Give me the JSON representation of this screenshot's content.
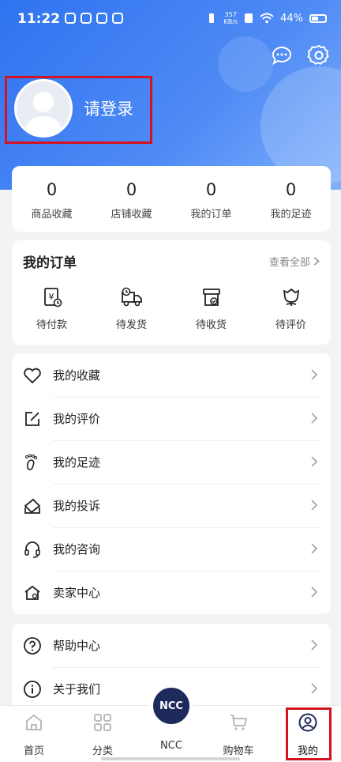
{
  "status_bar": {
    "time": "11:22",
    "net_speed_value": "357",
    "net_speed_unit": "KB/s",
    "battery": "44%"
  },
  "header": {
    "login_text": "请登录",
    "icons": [
      "message-icon",
      "settings-icon"
    ]
  },
  "stats": [
    {
      "value": "0",
      "label": "商品收藏"
    },
    {
      "value": "0",
      "label": "店铺收藏"
    },
    {
      "value": "0",
      "label": "我的订单"
    },
    {
      "value": "0",
      "label": "我的足迹"
    }
  ],
  "orders": {
    "title": "我的订单",
    "more": "查看全部",
    "items": [
      {
        "label": "待付款",
        "icon": "pending-payment-icon"
      },
      {
        "label": "待发货",
        "icon": "truck-icon"
      },
      {
        "label": "待收货",
        "icon": "box-icon"
      },
      {
        "label": "待评价",
        "icon": "flower-icon"
      }
    ]
  },
  "menu": [
    {
      "label": "我的收藏",
      "icon": "heart-icon"
    },
    {
      "label": "我的评价",
      "icon": "edit-icon"
    },
    {
      "label": "我的足迹",
      "icon": "footprint-icon"
    },
    {
      "label": "我的投诉",
      "icon": "complaint-icon"
    },
    {
      "label": "我的咨询",
      "icon": "headset-icon"
    },
    {
      "label": "卖家中心",
      "icon": "store-icon"
    }
  ],
  "menu2": [
    {
      "label": "帮助中心",
      "icon": "help-icon"
    },
    {
      "label": "关于我们",
      "icon": "info-icon"
    }
  ],
  "tabbar": {
    "tabs": [
      {
        "label": "首页",
        "icon": "home-icon"
      },
      {
        "label": "分类",
        "icon": "category-icon"
      },
      {
        "label": "NCC",
        "icon": "ncc-logo"
      },
      {
        "label": "购物车",
        "icon": "cart-icon"
      },
      {
        "label": "我的",
        "icon": "profile-icon"
      }
    ],
    "center_button": "NCC"
  },
  "colors": {
    "header_blue": "#3b7cf2",
    "highlight_red": "#d3131f",
    "ncc_navy": "#1f2a5c"
  }
}
